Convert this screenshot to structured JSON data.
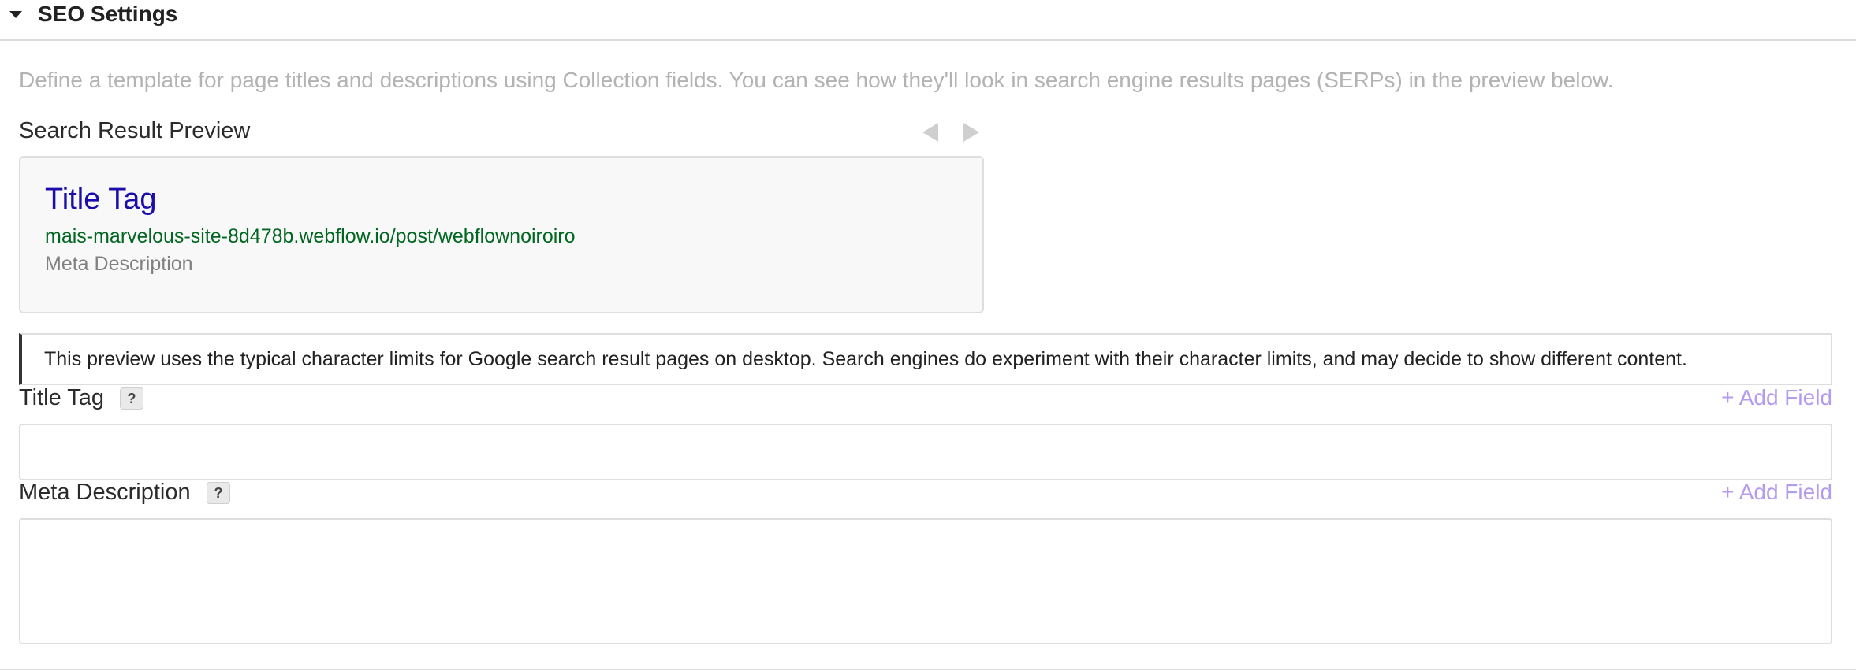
{
  "section": {
    "title": "SEO Settings",
    "intro": "Define a template for page titles and descriptions using Collection fields. You can see how they'll look in search engine results pages (SERPs) in the preview below."
  },
  "preview": {
    "label": "Search Result Preview",
    "title": "Title Tag",
    "url": "mais-marvelous-site-8d478b.webflow.io/post/webflownoiroiro",
    "description": "Meta Description",
    "prev_icon": "triangle-left-icon",
    "next_icon": "triangle-right-icon"
  },
  "notice": {
    "text": "This preview uses the typical character limits for Google search result pages on desktop. Search engines do experiment with their character limits, and may decide to show different content."
  },
  "fields": {
    "title_tag": {
      "label": "Title Tag",
      "help": "?",
      "add_field": "+ Add Field",
      "value": ""
    },
    "meta_description": {
      "label": "Meta Description",
      "help": "?",
      "add_field": "+ Add Field",
      "value": ""
    }
  },
  "colors": {
    "serp_title": "#1a0dab",
    "serp_url": "#006621",
    "add_field": "#b39cf0",
    "muted_text": "#b3b3b3"
  }
}
